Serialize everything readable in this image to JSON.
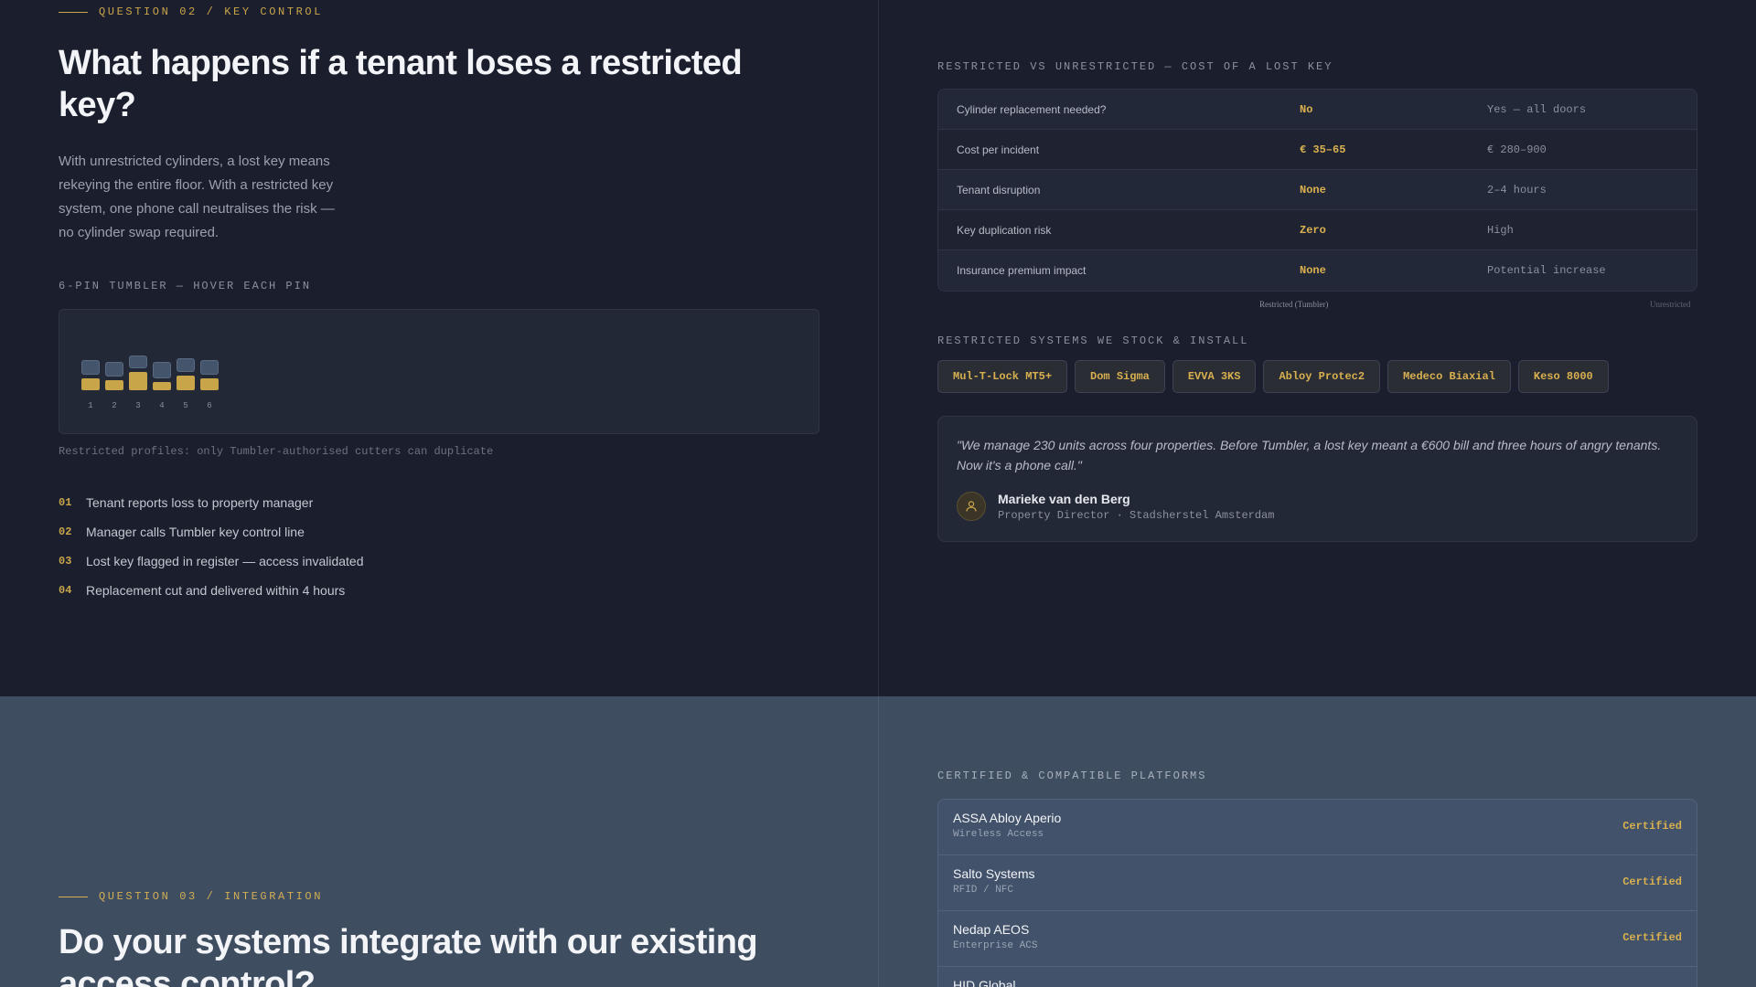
{
  "q2": {
    "eyebrow": "QUESTION 02 / KEY CONTROL",
    "title": "What happens if a tenant loses a restricted key?",
    "lead": "With unrestricted cylinders, a lost key means rekeying the entire floor. With a restricted key system, one phone call neutralises the risk — no cylinder swap required.",
    "tumbler_label": "6-PIN TUMBLER — HOVER EACH PIN",
    "pins": [
      {
        "label": "1",
        "key_level": 0.38,
        "driver_level": 0.46
      },
      {
        "label": "2",
        "key_level": 0.3,
        "driver_level": 0.46
      },
      {
        "label": "3",
        "key_level": 0.58,
        "driver_level": 0.4
      },
      {
        "label": "4",
        "key_level": 0.26,
        "driver_level": 0.52
      },
      {
        "label": "5",
        "key_level": 0.46,
        "driver_level": 0.44
      },
      {
        "label": "6",
        "key_level": 0.38,
        "driver_level": 0.46
      }
    ],
    "caption": "Restricted profiles: only Tumbler-authorised cutters can duplicate",
    "steps": [
      {
        "n": "01",
        "text": "Tenant reports loss to property manager"
      },
      {
        "n": "02",
        "text": "Manager calls Tumbler key control line"
      },
      {
        "n": "03",
        "text": "Lost key flagged in register — access invalidated"
      },
      {
        "n": "04",
        "text": "Replacement cut and delivered within 4 hours"
      }
    ]
  },
  "comparison": {
    "label": "RESTRICTED VS UNRESTRICTED — COST OF A LOST KEY",
    "rows": [
      {
        "metric": "Cylinder replacement needed?",
        "restricted": "No",
        "unrestricted": "Yes — all doors"
      },
      {
        "metric": "Cost per incident",
        "restricted": "€ 35–65",
        "unrestricted": "€ 280–900"
      },
      {
        "metric": "Tenant disruption",
        "restricted": "None",
        "unrestricted": "2–4 hours"
      },
      {
        "metric": "Key duplication risk",
        "restricted": "Zero",
        "unrestricted": "High"
      },
      {
        "metric": "Insurance premium impact",
        "restricted": "None",
        "unrestricted": "Potential increase"
      }
    ],
    "legend_restricted": "Restricted (Tumbler)",
    "legend_unrestricted": "Unrestricted"
  },
  "systems": {
    "label": "RESTRICTED SYSTEMS WE STOCK & INSTALL",
    "items": [
      "Mul-T-Lock MT5+",
      "Dom Sigma",
      "EVVA 3KS",
      "Abloy Protec2",
      "Medeco Biaxial",
      "Keso 8000"
    ]
  },
  "testimonial": {
    "quote": "\"We manage 230 units across four properties. Before Tumbler, a lost key meant a €600 bill and three hours of angry tenants. Now it's a phone call.\"",
    "name": "Marieke van den Berg",
    "role": "Property Director · Stadsherstel Amsterdam",
    "avatar_icon": "person-icon"
  },
  "platforms": {
    "label": "CERTIFIED & COMPATIBLE PLATFORMS",
    "items": [
      {
        "name": "ASSA Abloy Aperio",
        "type": "Wireless Access",
        "status": "Certified"
      },
      {
        "name": "Salto Systems",
        "type": "RFID / NFC",
        "status": "Certified"
      },
      {
        "name": "Nedap AEOS",
        "type": "Enterprise ACS",
        "status": "Certified"
      },
      {
        "name": "HID Global",
        "type": "",
        "status": ""
      }
    ]
  },
  "q3": {
    "eyebrow": "QUESTION 03 / INTEGRATION",
    "title": "Do your systems integrate with our existing access control?"
  },
  "colors": {
    "accent": "#c9a54a",
    "top_bg": "#1b1f2d",
    "bottom_bg": "#3e4d5f"
  }
}
